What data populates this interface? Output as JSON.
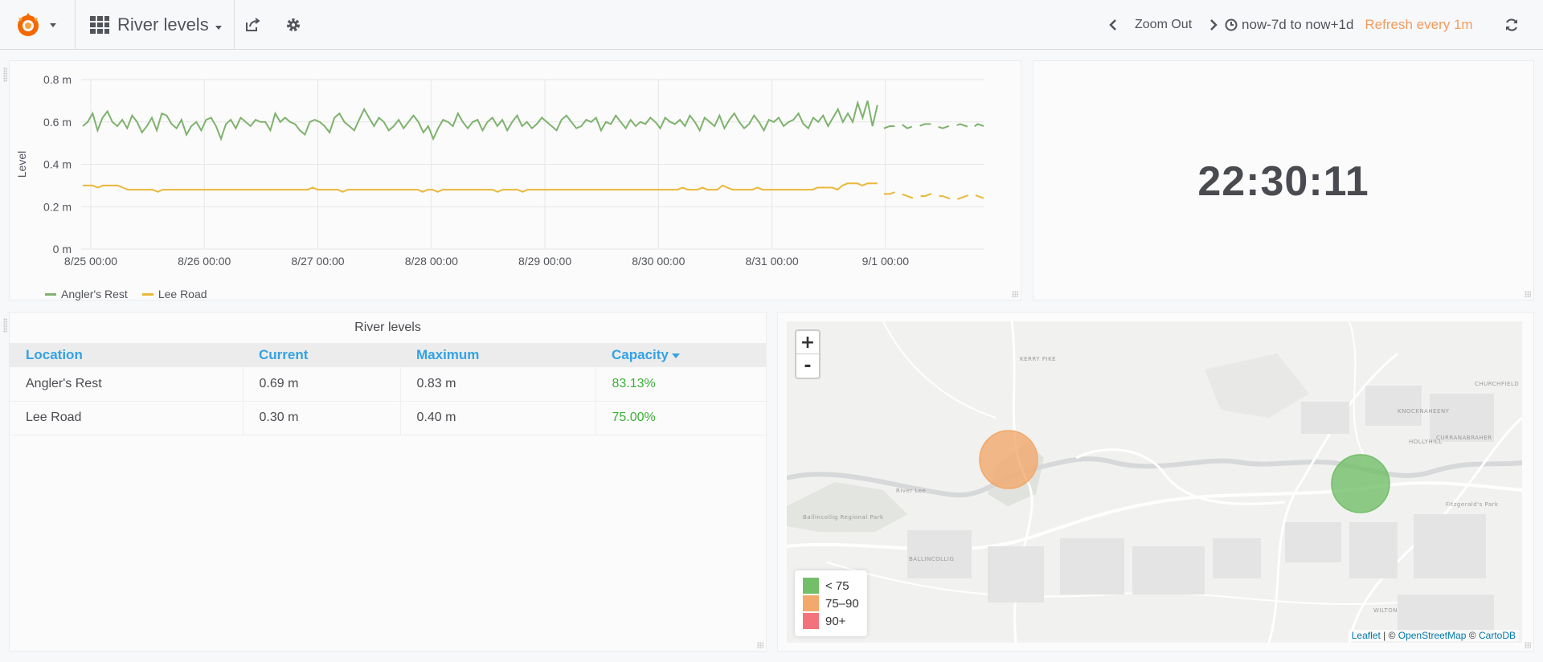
{
  "navbar": {
    "dashboard_title": "River levels",
    "zoom_out_label": "Zoom Out",
    "time_range": "now-7d to now+1d",
    "refresh_label": "Refresh every 1m"
  },
  "graph_panel": {
    "chart_data": {
      "type": "line",
      "ylabel": "Level",
      "xlabel": "",
      "ylim": [
        0,
        0.8
      ],
      "y_ticks": [
        "0 m",
        "0.2 m",
        "0.4 m",
        "0.6 m",
        "0.8 m"
      ],
      "x_ticks": [
        "8/25 00:00",
        "8/26 00:00",
        "8/27 00:00",
        "8/28 00:00",
        "8/29 00:00",
        "8/30 00:00",
        "8/31 00:00",
        "9/1 00:00"
      ],
      "legend_placement": "bottom-left",
      "grid": true,
      "series": [
        {
          "name": "Angler's Rest",
          "color": "#7eb26d",
          "values": [
            0.58,
            0.6,
            0.64,
            0.56,
            0.62,
            0.65,
            0.6,
            0.58,
            0.61,
            0.57,
            0.63,
            0.6,
            0.55,
            0.58,
            0.62,
            0.56,
            0.64,
            0.63,
            0.59,
            0.57,
            0.61,
            0.54,
            0.58,
            0.6,
            0.56,
            0.61,
            0.62,
            0.58,
            0.52,
            0.59,
            0.61,
            0.57,
            0.62,
            0.6,
            0.58,
            0.61,
            0.6,
            0.6,
            0.56,
            0.64,
            0.6,
            0.62,
            0.6,
            0.59,
            0.56,
            0.54,
            0.6,
            0.61,
            0.6,
            0.58,
            0.55,
            0.62,
            0.64,
            0.6,
            0.58,
            0.56,
            0.61,
            0.66,
            0.62,
            0.58,
            0.62,
            0.6,
            0.56,
            0.58,
            0.61,
            0.57,
            0.6,
            0.63,
            0.6,
            0.55,
            0.58,
            0.52,
            0.57,
            0.61,
            0.6,
            0.58,
            0.64,
            0.6,
            0.57,
            0.6,
            0.61,
            0.56,
            0.6,
            0.62,
            0.58,
            0.61,
            0.56,
            0.6,
            0.63,
            0.58,
            0.6,
            0.57,
            0.59,
            0.62,
            0.6,
            0.58,
            0.56,
            0.61,
            0.63,
            0.6,
            0.57,
            0.58,
            0.61,
            0.6,
            0.62,
            0.56,
            0.6,
            0.59,
            0.63,
            0.6,
            0.57,
            0.61,
            0.58,
            0.6,
            0.59,
            0.62,
            0.6,
            0.57,
            0.62,
            0.6,
            0.59,
            0.61,
            0.58,
            0.63,
            0.6,
            0.56,
            0.62,
            0.6,
            0.58,
            0.63,
            0.57,
            0.61,
            0.64,
            0.6,
            0.57,
            0.59,
            0.63,
            0.6,
            0.56,
            0.61,
            0.6,
            0.62,
            0.58,
            0.6,
            0.61,
            0.64,
            0.59,
            0.57,
            0.62,
            0.6,
            0.63,
            0.58,
            0.62,
            0.66,
            0.6,
            0.64,
            0.6,
            0.69,
            0.62,
            0.7,
            0.58,
            0.68
          ],
          "forecast": [
            0.57,
            0.58,
            0.58,
            0.59,
            0.57,
            0.58,
            0.58,
            0.59,
            0.59,
            0.58,
            0.57,
            0.58,
            0.58,
            0.59,
            0.58,
            0.57,
            0.59,
            0.58
          ]
        },
        {
          "name": "Lee Road",
          "color": "#eab839",
          "values": [
            0.3,
            0.3,
            0.3,
            0.29,
            0.3,
            0.3,
            0.3,
            0.3,
            0.29,
            0.28,
            0.28,
            0.28,
            0.28,
            0.28,
            0.28,
            0.27,
            0.28,
            0.28,
            0.28,
            0.28,
            0.28,
            0.28,
            0.28,
            0.28,
            0.28,
            0.28,
            0.28,
            0.28,
            0.28,
            0.28,
            0.28,
            0.28,
            0.28,
            0.28,
            0.28,
            0.28,
            0.28,
            0.28,
            0.28,
            0.28,
            0.28,
            0.28,
            0.28,
            0.28,
            0.28,
            0.28,
            0.29,
            0.28,
            0.28,
            0.28,
            0.28,
            0.28,
            0.27,
            0.28,
            0.28,
            0.28,
            0.28,
            0.28,
            0.28,
            0.28,
            0.28,
            0.28,
            0.28,
            0.28,
            0.28,
            0.28,
            0.28,
            0.28,
            0.27,
            0.28,
            0.28,
            0.27,
            0.28,
            0.28,
            0.28,
            0.28,
            0.28,
            0.28,
            0.28,
            0.28,
            0.28,
            0.28,
            0.28,
            0.27,
            0.28,
            0.28,
            0.28,
            0.28,
            0.27,
            0.28,
            0.28,
            0.28,
            0.28,
            0.28,
            0.28,
            0.28,
            0.28,
            0.28,
            0.28,
            0.28,
            0.28,
            0.28,
            0.28,
            0.28,
            0.28,
            0.28,
            0.28,
            0.28,
            0.28,
            0.28,
            0.28,
            0.28,
            0.28,
            0.28,
            0.28,
            0.28,
            0.28,
            0.28,
            0.28,
            0.28,
            0.29,
            0.28,
            0.28,
            0.28,
            0.29,
            0.28,
            0.28,
            0.28,
            0.3,
            0.29,
            0.28,
            0.28,
            0.28,
            0.28,
            0.28,
            0.29,
            0.28,
            0.28,
            0.28,
            0.28,
            0.28,
            0.28,
            0.28,
            0.28,
            0.28,
            0.28,
            0.28,
            0.29,
            0.29,
            0.29,
            0.29,
            0.28,
            0.3,
            0.31,
            0.31,
            0.31,
            0.3,
            0.31,
            0.31,
            0.31
          ],
          "forecast": [
            0.26,
            0.26,
            0.27,
            0.26,
            0.25,
            0.24,
            0.25,
            0.25,
            0.26,
            0.25,
            0.25,
            0.24,
            0.23,
            0.24,
            0.25,
            0.26,
            0.25,
            0.24
          ]
        }
      ]
    }
  },
  "clock_panel": {
    "time": "22:30:11"
  },
  "table_panel": {
    "title": "River levels",
    "columns": [
      "Location",
      "Current",
      "Maximum",
      "Capacity"
    ],
    "rows": [
      [
        "Angler's Rest",
        "0.69 m",
        "0.83 m",
        "83.13%"
      ],
      [
        "Lee Road",
        "0.30 m",
        "0.40 m",
        "75.00%"
      ]
    ]
  },
  "map_panel": {
    "zoom_in": "+",
    "zoom_out": "-",
    "legend": [
      {
        "label": "< 75",
        "color": "#73bf69"
      },
      {
        "label": "75–90",
        "color": "#f2a96b"
      },
      {
        "label": "90+",
        "color": "#f2737b"
      }
    ],
    "markers": [
      {
        "location": "Angler's Rest",
        "color": "#f2a96b"
      },
      {
        "location": "Lee Road",
        "color": "#73bf69"
      }
    ],
    "place_labels": [
      "KERRY PIKE",
      "KNOCKNAHEENY",
      "CHURCHFIELD",
      "HOLLYHILL",
      "CURRANABRAHER",
      "BALLINCOLLIG",
      "WILTON",
      "River Lee",
      "Fitzgerald's Park",
      "Ballincollig Regional Park"
    ],
    "attribution": {
      "leaflet": "Leaflet",
      "sep1": " | © ",
      "osm": "OpenStreetMap",
      "sep2": " © ",
      "carto": "CartoDB"
    }
  }
}
